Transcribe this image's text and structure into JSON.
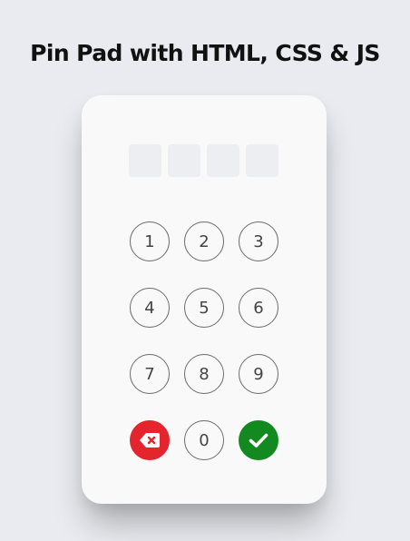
{
  "header": {
    "title": "Pin Pad with HTML, CSS & JS"
  },
  "pin_display": {
    "digits": [
      "",
      "",
      "",
      ""
    ]
  },
  "keypad": {
    "keys": [
      "1",
      "2",
      "3",
      "4",
      "5",
      "6",
      "7",
      "8",
      "9",
      "0"
    ],
    "delete_icon": "backspace-x-icon",
    "submit_icon": "checkmark-icon"
  },
  "colors": {
    "background": "#e9ebf0",
    "card": "#f9f9fa",
    "delete": "#e4252d",
    "submit": "#138a1f"
  }
}
